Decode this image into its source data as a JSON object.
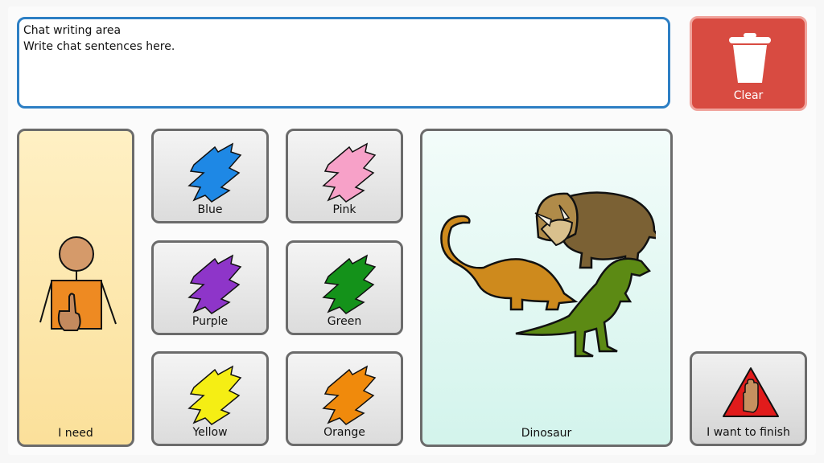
{
  "chat": {
    "title": "Chat writing area",
    "placeholder": "Write chat sentences here."
  },
  "clear": {
    "label": "Clear",
    "icon": "trash-icon",
    "color": "#d84b41"
  },
  "need": {
    "label": "I need",
    "icon": "person-pointing-self-icon"
  },
  "colors": [
    {
      "label": "Blue",
      "color": "#1e88e5"
    },
    {
      "label": "Pink",
      "color": "#f7a1c8"
    },
    {
      "label": "Purple",
      "color": "#8e35c9"
    },
    {
      "label": "Green",
      "color": "#14921a"
    },
    {
      "label": "Yellow",
      "color": "#f5ee14"
    },
    {
      "label": "Orange",
      "color": "#f08a0c"
    }
  ],
  "dinosaur": {
    "label": "Dinosaur",
    "icon": "dinosaurs-icon"
  },
  "finish": {
    "label": "I want to finish",
    "icon": "stop-hand-icon",
    "color": "#e11b1b"
  }
}
